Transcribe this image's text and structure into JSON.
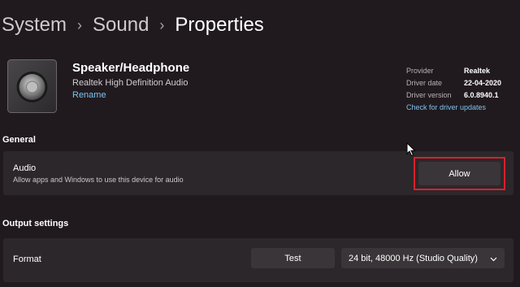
{
  "breadcrumb": [
    "System",
    "Sound",
    "Properties"
  ],
  "device": {
    "name": "Speaker/Headphone",
    "subtitle": "Realtek High Definition Audio",
    "rename_link": "Rename",
    "icon": "speaker-icon"
  },
  "driver_info": {
    "provider_label": "Provider",
    "provider_value": "Realtek",
    "date_label": "Driver date",
    "date_value": "22-04-2020",
    "version_label": "Driver version",
    "version_value": "6.0.8940.1",
    "update_link": "Check for driver updates"
  },
  "general": {
    "title": "General",
    "audio_title": "Audio",
    "audio_desc": "Allow apps and Windows to use this device for audio",
    "allow_button": "Allow"
  },
  "output": {
    "title": "Output settings",
    "format_label": "Format",
    "test_button": "Test",
    "format_value": "24 bit, 48000 Hz (Studio Quality)"
  },
  "colors": {
    "background": "#201a1e",
    "card": "#2c272b",
    "button": "#3a3538",
    "link": "#7ec3f0",
    "highlight": "#d9202a"
  }
}
